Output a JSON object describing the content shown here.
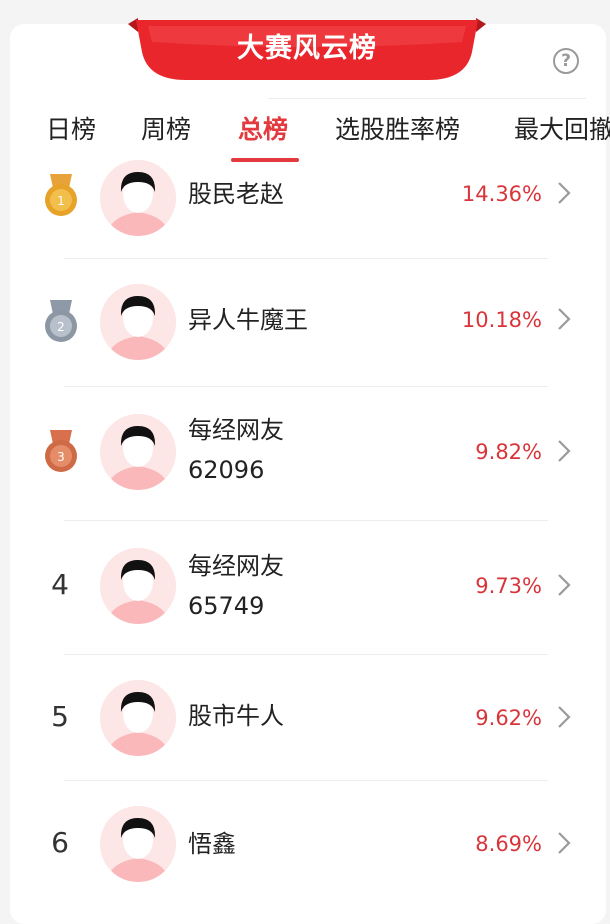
{
  "header": {
    "title": "大赛风云榜",
    "help_label": "?"
  },
  "tabs": [
    {
      "label": "日榜"
    },
    {
      "label": "周榜"
    },
    {
      "label": "总榜",
      "active": true
    },
    {
      "label": "选股胜率榜"
    },
    {
      "label": "最大回撤"
    }
  ],
  "rankings": [
    {
      "rank": "1",
      "medal": "gold-medal-icon",
      "name_line1": "股民老赵",
      "name_line2": "",
      "return": "14.36%"
    },
    {
      "rank": "2",
      "medal": "silver-medal-icon",
      "name_line1": "异人牛魔王",
      "name_line2": "",
      "return": "10.18%"
    },
    {
      "rank": "3",
      "medal": "bronze-medal-icon",
      "name_line1": "每经网友",
      "name_line2": "62096",
      "return": "9.82%"
    },
    {
      "rank": "4",
      "medal": "",
      "name_line1": "每经网友",
      "name_line2": "65749",
      "return": "9.73%"
    },
    {
      "rank": "5",
      "medal": "",
      "name_line1": "股市牛人",
      "name_line2": "",
      "return": "9.62%"
    },
    {
      "rank": "6",
      "medal": "",
      "name_line1": "悟鑫",
      "name_line2": "",
      "return": "8.69%"
    }
  ],
  "colors": {
    "accent": "#e23a3e",
    "banner": "#e8262c",
    "avatar_bg": "#fde6e6"
  },
  "icons": {
    "help": "question-icon",
    "chevron": "chevron-right-icon",
    "avatar": "default-avatar-icon"
  }
}
